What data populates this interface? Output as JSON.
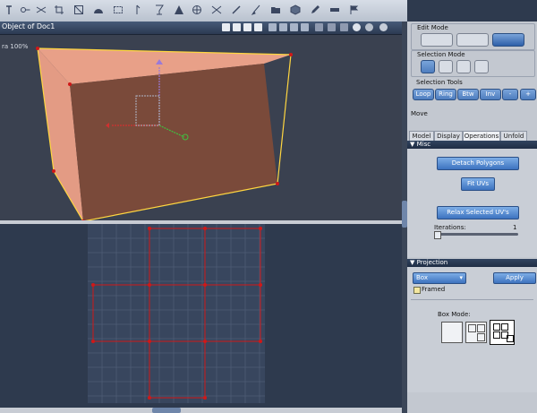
{
  "viewport": {
    "title": "Object of Doc1",
    "camera_label": "ra 100%"
  },
  "toolbar": {
    "icons": [
      "text-icon",
      "key-icon",
      "scissors-icon",
      "crop-icon",
      "frame-icon",
      "half-dome-icon",
      "selection-icon",
      "move-icon",
      "goblet-icon",
      "cone-icon",
      "globe-icon",
      "pinch-icon",
      "wand-icon",
      "brush-icon",
      "folder-icon",
      "cube-icon",
      "pencil-icon",
      "ruler-icon",
      "flag-icon"
    ]
  },
  "panel": {
    "edit_mode": {
      "title": "Edit Mode",
      "icons": [
        "object-mode-icon",
        "points-mode-icon",
        "mesh-mode-icon"
      ]
    },
    "selection_mode": {
      "title": "Selection Mode",
      "icons": [
        "arrow-select-icon",
        "point-select-icon",
        "edge-select-icon",
        "face-select-icon"
      ]
    },
    "selection_tools": {
      "title": "Selection Tools",
      "buttons": [
        "Loop",
        "Ring",
        "Btw",
        "Inv",
        "-",
        "+"
      ]
    },
    "move_label": "Move",
    "tabs": [
      "Model",
      "Display",
      "Operations",
      "Unfold"
    ],
    "active_tab": "Operations",
    "misc": {
      "title": "Misc",
      "detach": "Detach Polygons",
      "fit": "Fit UVs",
      "relax": "Relax Selected UV's",
      "iterations_label": "Iterations:",
      "iterations_value": "1"
    },
    "projection": {
      "title": "Projection",
      "type": "Box",
      "apply": "Apply",
      "framed_label": "Framed",
      "box_mode_label": "Box Mode:"
    }
  },
  "colors": {
    "accent": "#4e7dbf",
    "uv_lines": "#d01818",
    "box_face": "#e8a088",
    "box_front": "#7a4a3a"
  }
}
